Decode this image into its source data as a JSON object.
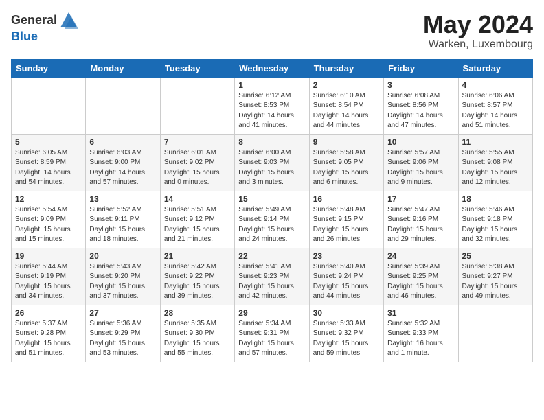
{
  "header": {
    "logo_general": "General",
    "logo_blue": "Blue",
    "month_title": "May 2024",
    "location": "Warken, Luxembourg"
  },
  "weekdays": [
    "Sunday",
    "Monday",
    "Tuesday",
    "Wednesday",
    "Thursday",
    "Friday",
    "Saturday"
  ],
  "weeks": [
    [
      {
        "day": "",
        "info": ""
      },
      {
        "day": "",
        "info": ""
      },
      {
        "day": "",
        "info": ""
      },
      {
        "day": "1",
        "info": "Sunrise: 6:12 AM\nSunset: 8:53 PM\nDaylight: 14 hours\nand 41 minutes."
      },
      {
        "day": "2",
        "info": "Sunrise: 6:10 AM\nSunset: 8:54 PM\nDaylight: 14 hours\nand 44 minutes."
      },
      {
        "day": "3",
        "info": "Sunrise: 6:08 AM\nSunset: 8:56 PM\nDaylight: 14 hours\nand 47 minutes."
      },
      {
        "day": "4",
        "info": "Sunrise: 6:06 AM\nSunset: 8:57 PM\nDaylight: 14 hours\nand 51 minutes."
      }
    ],
    [
      {
        "day": "5",
        "info": "Sunrise: 6:05 AM\nSunset: 8:59 PM\nDaylight: 14 hours\nand 54 minutes."
      },
      {
        "day": "6",
        "info": "Sunrise: 6:03 AM\nSunset: 9:00 PM\nDaylight: 14 hours\nand 57 minutes."
      },
      {
        "day": "7",
        "info": "Sunrise: 6:01 AM\nSunset: 9:02 PM\nDaylight: 15 hours\nand 0 minutes."
      },
      {
        "day": "8",
        "info": "Sunrise: 6:00 AM\nSunset: 9:03 PM\nDaylight: 15 hours\nand 3 minutes."
      },
      {
        "day": "9",
        "info": "Sunrise: 5:58 AM\nSunset: 9:05 PM\nDaylight: 15 hours\nand 6 minutes."
      },
      {
        "day": "10",
        "info": "Sunrise: 5:57 AM\nSunset: 9:06 PM\nDaylight: 15 hours\nand 9 minutes."
      },
      {
        "day": "11",
        "info": "Sunrise: 5:55 AM\nSunset: 9:08 PM\nDaylight: 15 hours\nand 12 minutes."
      }
    ],
    [
      {
        "day": "12",
        "info": "Sunrise: 5:54 AM\nSunset: 9:09 PM\nDaylight: 15 hours\nand 15 minutes."
      },
      {
        "day": "13",
        "info": "Sunrise: 5:52 AM\nSunset: 9:11 PM\nDaylight: 15 hours\nand 18 minutes."
      },
      {
        "day": "14",
        "info": "Sunrise: 5:51 AM\nSunset: 9:12 PM\nDaylight: 15 hours\nand 21 minutes."
      },
      {
        "day": "15",
        "info": "Sunrise: 5:49 AM\nSunset: 9:14 PM\nDaylight: 15 hours\nand 24 minutes."
      },
      {
        "day": "16",
        "info": "Sunrise: 5:48 AM\nSunset: 9:15 PM\nDaylight: 15 hours\nand 26 minutes."
      },
      {
        "day": "17",
        "info": "Sunrise: 5:47 AM\nSunset: 9:16 PM\nDaylight: 15 hours\nand 29 minutes."
      },
      {
        "day": "18",
        "info": "Sunrise: 5:46 AM\nSunset: 9:18 PM\nDaylight: 15 hours\nand 32 minutes."
      }
    ],
    [
      {
        "day": "19",
        "info": "Sunrise: 5:44 AM\nSunset: 9:19 PM\nDaylight: 15 hours\nand 34 minutes."
      },
      {
        "day": "20",
        "info": "Sunrise: 5:43 AM\nSunset: 9:20 PM\nDaylight: 15 hours\nand 37 minutes."
      },
      {
        "day": "21",
        "info": "Sunrise: 5:42 AM\nSunset: 9:22 PM\nDaylight: 15 hours\nand 39 minutes."
      },
      {
        "day": "22",
        "info": "Sunrise: 5:41 AM\nSunset: 9:23 PM\nDaylight: 15 hours\nand 42 minutes."
      },
      {
        "day": "23",
        "info": "Sunrise: 5:40 AM\nSunset: 9:24 PM\nDaylight: 15 hours\nand 44 minutes."
      },
      {
        "day": "24",
        "info": "Sunrise: 5:39 AM\nSunset: 9:25 PM\nDaylight: 15 hours\nand 46 minutes."
      },
      {
        "day": "25",
        "info": "Sunrise: 5:38 AM\nSunset: 9:27 PM\nDaylight: 15 hours\nand 49 minutes."
      }
    ],
    [
      {
        "day": "26",
        "info": "Sunrise: 5:37 AM\nSunset: 9:28 PM\nDaylight: 15 hours\nand 51 minutes."
      },
      {
        "day": "27",
        "info": "Sunrise: 5:36 AM\nSunset: 9:29 PM\nDaylight: 15 hours\nand 53 minutes."
      },
      {
        "day": "28",
        "info": "Sunrise: 5:35 AM\nSunset: 9:30 PM\nDaylight: 15 hours\nand 55 minutes."
      },
      {
        "day": "29",
        "info": "Sunrise: 5:34 AM\nSunset: 9:31 PM\nDaylight: 15 hours\nand 57 minutes."
      },
      {
        "day": "30",
        "info": "Sunrise: 5:33 AM\nSunset: 9:32 PM\nDaylight: 15 hours\nand 59 minutes."
      },
      {
        "day": "31",
        "info": "Sunrise: 5:32 AM\nSunset: 9:33 PM\nDaylight: 16 hours\nand 1 minute."
      },
      {
        "day": "",
        "info": ""
      }
    ]
  ]
}
